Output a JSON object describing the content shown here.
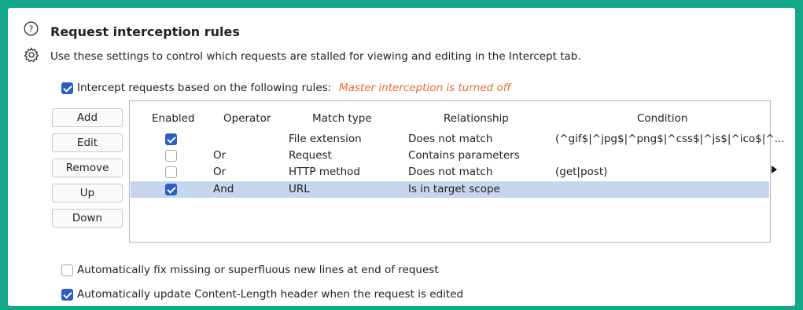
{
  "header": {
    "title": "Request interception rules",
    "description": "Use these settings to control which requests are stalled for viewing and editing in the Intercept tab."
  },
  "intercept_rules": {
    "checked": true,
    "label": "Intercept requests based on the following rules:",
    "warning": "Master interception is turned off"
  },
  "buttons": {
    "add": "Add",
    "edit": "Edit",
    "remove": "Remove",
    "up": "Up",
    "down": "Down"
  },
  "table": {
    "headers": {
      "enabled": "Enabled",
      "operator": "Operator",
      "match_type": "Match type",
      "relationship": "Relationship",
      "condition": "Condition"
    },
    "rows": [
      {
        "enabled": true,
        "operator": "",
        "match_type": "File extension",
        "relationship": "Does not match",
        "condition": "(^gif$|^jpg$|^png$|^css$|^js$|^ico$|^..."
      },
      {
        "enabled": false,
        "operator": "Or",
        "match_type": "Request",
        "relationship": "Contains parameters",
        "condition": ""
      },
      {
        "enabled": false,
        "operator": "Or",
        "match_type": "HTTP method",
        "relationship": "Does not match",
        "condition": "(get|post)"
      },
      {
        "enabled": true,
        "operator": "And",
        "match_type": "URL",
        "relationship": "Is in target scope",
        "condition": "",
        "selected": true
      }
    ]
  },
  "options": {
    "fix_newlines": {
      "checked": false,
      "label": "Automatically fix missing or superfluous new lines at end of request"
    },
    "update_content_length": {
      "checked": true,
      "label": "Automatically update Content-Length header when the request is edited"
    }
  },
  "colors": {
    "frame": "#12a888",
    "checkbox": "#2a5ec4",
    "selection": "#c6d6ec",
    "warning": "#f06a32"
  },
  "icons": [
    "help-icon",
    "gear-icon",
    "scroll-right-arrow-icon"
  ]
}
